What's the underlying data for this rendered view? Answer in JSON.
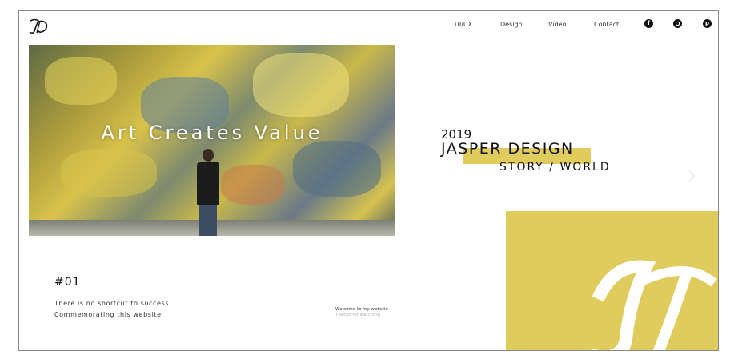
{
  "header": {
    "logo_text": "JD",
    "nav": [
      "UI/UX",
      "Design",
      "Video",
      "Contact"
    ],
    "social": [
      {
        "name": "facebook-icon",
        "glyph": "f"
      },
      {
        "name": "instagram-icon",
        "glyph": ""
      },
      {
        "name": "pinterest-icon",
        "glyph": "p"
      }
    ]
  },
  "hero": {
    "title": "Art Creates Value"
  },
  "brand": {
    "year": "2019",
    "name": "JASPER DESIGN",
    "tagline": "STORY / WORLD",
    "accent_color": "#e0cc5c"
  },
  "section": {
    "number": "#01",
    "line1": "There is no shortcut to success",
    "line2": "Commemorating this website"
  },
  "footer_note": {
    "welcome": "Welcome to my website",
    "thanks": "Thanks for watching"
  }
}
